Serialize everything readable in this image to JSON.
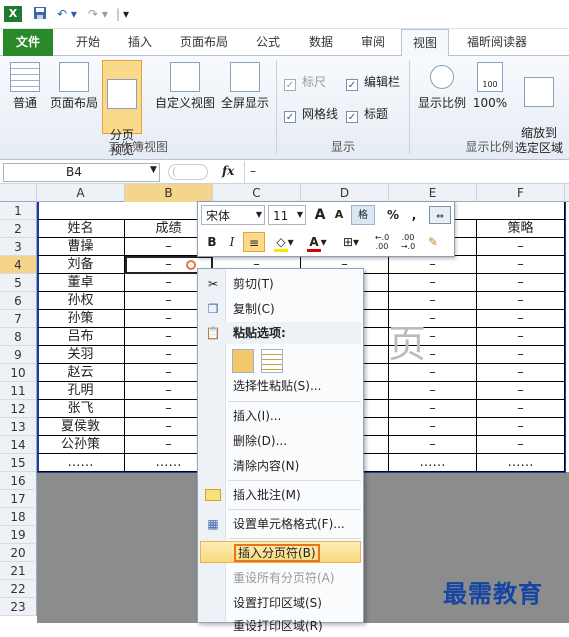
{
  "titlebar": {
    "save_icon": "save-icon",
    "undo_glyph": "↶ ▾",
    "redo_glyph": "↷ ▾",
    "sep": "|",
    "customize_glyph": "▾"
  },
  "tabs": [
    {
      "label": "文件"
    },
    {
      "label": "开始"
    },
    {
      "label": "插入"
    },
    {
      "label": "页面布局"
    },
    {
      "label": "公式"
    },
    {
      "label": "数据"
    },
    {
      "label": "审阅"
    },
    {
      "label": "视图"
    },
    {
      "label": "福昕阅读器"
    }
  ],
  "ribbon": {
    "workbook_views": {
      "label": "工作簿视图",
      "normal": "普通",
      "page_layout": "页面布局",
      "page_break_preview": "分页\n预览",
      "custom_views": "自定义视图",
      "full_screen": "全屏显示"
    },
    "show": {
      "label": "显示",
      "ruler": "标尺",
      "formula_bar": "编辑栏",
      "gridlines": "网格线",
      "headings": "标题"
    },
    "zoom": {
      "label": "显示比例",
      "zoom": "显示比例",
      "zoom100": "100%",
      "zoom_selection": "缩放到\n选定区域",
      "zoom100_icon_text": "100"
    }
  },
  "formula_bar": {
    "cell": "B4",
    "fx": "fx",
    "value": "–"
  },
  "columns": [
    "A",
    "B",
    "C",
    "D",
    "E",
    "F"
  ],
  "rows": [
    "1",
    "2",
    "3",
    "4",
    "5",
    "6",
    "7",
    "8",
    "9",
    "10",
    "11",
    "12",
    "13",
    "14",
    "15",
    "16",
    "17",
    "18",
    "19",
    "20",
    "21",
    "22",
    "23"
  ],
  "table": {
    "header": [
      "姓名",
      "成绩",
      "",
      "",
      "",
      "策略"
    ],
    "names": [
      "曹操",
      "刘备",
      "董卓",
      "孙权",
      "孙策",
      "吕布",
      "关羽",
      "赵云",
      "孔明",
      "张飞",
      "夏侯敦",
      "公孙策",
      "……"
    ],
    "dash": "–",
    "ellipsis": "……"
  },
  "mini_toolbar": {
    "font": "宋体",
    "size": "11",
    "grow": "A",
    "shrink": "A",
    "format_icon": "格",
    "percent": "%",
    "comma": ",",
    "bold": "B",
    "italic": "I",
    "font_color_label": "A",
    "dec_inc": "←.0\n.00",
    "dec_dec": ".00\n→.0"
  },
  "context_menu": {
    "cut": "剪切(T)",
    "copy": "复制(C)",
    "paste_options": "粘贴选项:",
    "paste_special": "选择性粘贴(S)...",
    "insert": "插入(I)...",
    "delete": "删除(D)...",
    "clear": "清除内容(N)",
    "insert_comment": "插入批注(M)",
    "format_cells": "设置单元格格式(F)...",
    "insert_page_break": "插入分页符(B)",
    "reset_page_breaks": "重设所有分页符(A)",
    "set_print_area": "设置打印区域(S)",
    "reset_print_area": "重设打印区域(R)"
  },
  "page_watermark": "页",
  "watermark": "最需教育",
  "colors": {
    "accent": "#2a8a2a",
    "selection": "#f5d58b",
    "highlight": "#f9d97a",
    "watermark": "#1646a3"
  }
}
